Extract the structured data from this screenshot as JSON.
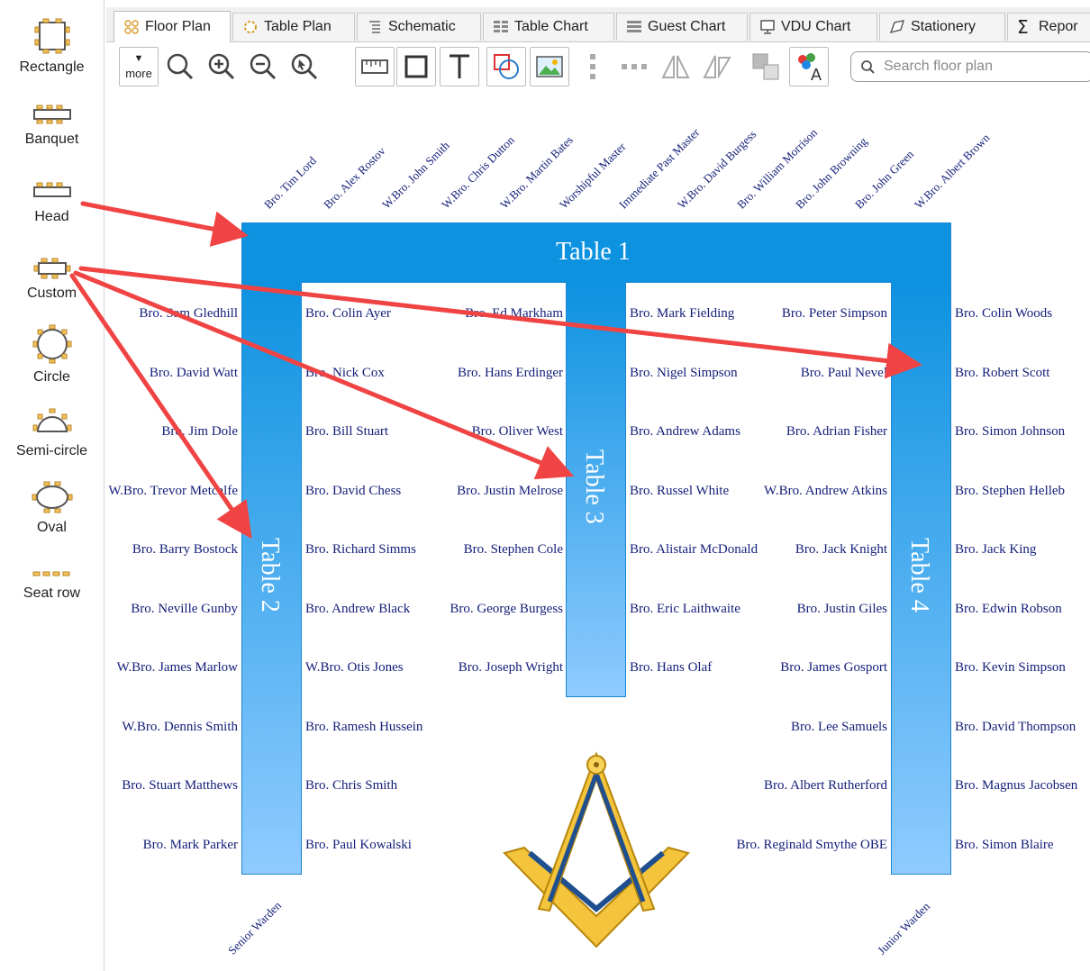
{
  "palette": {
    "items": [
      {
        "label": "Rectangle",
        "icon": "rectangle-table-icon"
      },
      {
        "label": "Banquet",
        "icon": "banquet-table-icon"
      },
      {
        "label": "Head",
        "icon": "head-table-icon"
      },
      {
        "label": "Custom",
        "icon": "custom-table-icon"
      },
      {
        "label": "Circle",
        "icon": "circle-table-icon"
      },
      {
        "label": "Semi-circle",
        "icon": "semi-circle-table-icon"
      },
      {
        "label": "Oval",
        "icon": "oval-table-icon"
      },
      {
        "label": "Seat row",
        "icon": "seat-row-icon"
      }
    ]
  },
  "tabs": [
    {
      "label": "Floor Plan",
      "icon": "floor-plan-icon",
      "active": true
    },
    {
      "label": "Table Plan",
      "icon": "table-plan-icon"
    },
    {
      "label": "Schematic",
      "icon": "schematic-icon"
    },
    {
      "label": "Table Chart",
      "icon": "table-chart-icon"
    },
    {
      "label": "Guest Chart",
      "icon": "guest-chart-icon"
    },
    {
      "label": "VDU Chart",
      "icon": "vdu-chart-icon"
    },
    {
      "label": "Stationery",
      "icon": "stationery-icon"
    },
    {
      "label": "Repor",
      "icon": "sigma-icon"
    }
  ],
  "toolbar": {
    "more_label": "more",
    "search_placeholder": "Search floor plan"
  },
  "floor": {
    "tables": {
      "t1": "Table 1",
      "t2": "Table 2",
      "t3": "Table 3",
      "t4": "Table 4"
    },
    "head_seats": [
      "Bro. Tim Lord",
      "Bro. Alex Rostov",
      "W.Bro. John Smith",
      "W.Bro. Chris Dutton",
      "W.Bro. Martin Bates",
      "Worshipful Master",
      "Immediate Past Master",
      "W.Bro. David Burgess",
      "Bro. William Morrison",
      "Bro. John Browning",
      "Bro. John Green",
      "W.Bro. Albert Brown"
    ],
    "col_t2_left": [
      "Bro. Sam Gledhill",
      "Bro. David Watt",
      "Bro. Jim Dole",
      "W.Bro. Trevor Metcalfe",
      "Bro. Barry Bostock",
      "Bro. Neville Gunby",
      "W.Bro. James Marlow",
      "W.Bro. Dennis Smith",
      "Bro. Stuart Matthews",
      "Bro. Mark Parker"
    ],
    "col_t2_right": [
      "Bro. Colin Ayer",
      "Bro. Nick Cox",
      "Bro. Bill Stuart",
      "Bro. David Chess",
      "Bro. Richard Simms",
      "Bro. Andrew Black",
      "W.Bro. Otis Jones",
      "Bro. Ramesh Hussein",
      "Bro. Chris Smith",
      "Bro. Paul Kowalski"
    ],
    "col_t3_left": [
      "Bro. Ed Markham",
      "Bro. Hans Erdinger",
      "Bro. Oliver West",
      "Bro. Justin Melrose",
      "Bro. Stephen Cole",
      "Bro. George Burgess",
      "Bro. Joseph Wright"
    ],
    "col_t3_right": [
      "Bro. Mark Fielding",
      "Bro. Nigel Simpson",
      "Bro. Andrew Adams",
      "Bro. Russel White",
      "Bro. Alistair McDonald",
      "Bro. Eric Laithwaite",
      "Bro. Hans Olaf"
    ],
    "col_t4_left": [
      "Bro. Peter Simpson",
      "Bro. Paul Nevel",
      "Bro. Adrian Fisher",
      "W.Bro. Andrew Atkins",
      "Bro. Jack Knight",
      "Bro. Justin Giles",
      "Bro. James Gosport",
      "Bro. Lee Samuels",
      "Bro. Albert Rutherford",
      "Bro. Reginald Smythe OBE"
    ],
    "col_t4_right": [
      "Bro. Colin Woods",
      "Bro. Robert Scott",
      "Bro. Simon Johnson",
      "Bro. Stephen Helleb",
      "Bro. Jack King",
      "Bro. Edwin Robson",
      "Bro. Kevin Simpson",
      "Bro. David Thompson",
      "Bro. Magnus Jacobsen",
      "Bro. Simon Blaire"
    ],
    "senior_warden": "Senior Warden",
    "junior_warden": "Junior Warden"
  },
  "colors": {
    "table_top": "#0d92e0",
    "table_bottom": "#8fcbff",
    "guest_text": "#15207a",
    "arrow": "#f04444",
    "palette_icon_fill": "#f6c35a"
  }
}
